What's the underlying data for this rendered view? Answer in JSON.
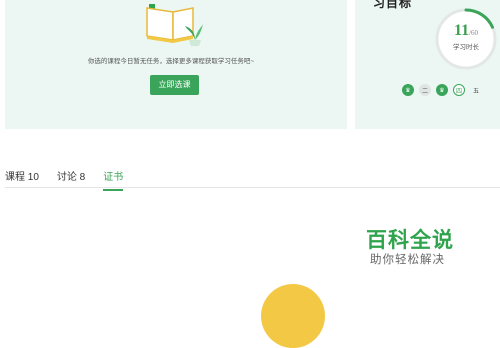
{
  "today_tasks": {
    "empty_message": "你选的课程今日暂无任务，选择更多课程获取学习任务吧~",
    "select_button_label": "立即选课"
  },
  "study_goal": {
    "title_partial": "习目标",
    "minutes_done": "11",
    "minutes_target": "/60",
    "progress_fraction": 0.183,
    "label": "学习时长",
    "week": [
      {
        "label": "♛",
        "state": "done"
      },
      {
        "label": "二",
        "state": "todo"
      },
      {
        "label": "♛",
        "state": "done"
      },
      {
        "label": "四",
        "state": "today"
      },
      {
        "label": "五",
        "state": "future"
      }
    ]
  },
  "tabs": [
    {
      "label": "课程 10"
    },
    {
      "label": "讨论 8"
    },
    {
      "label": "证书",
      "active": true
    }
  ],
  "watermark": {
    "title": "百科全说",
    "subtitle": "助你轻松解决"
  },
  "colors": {
    "accent": "#3aa55a",
    "panel_bg": "#ecf7f4",
    "watermark_green": "#2fa44d",
    "circle_yellow": "#f3c845"
  }
}
